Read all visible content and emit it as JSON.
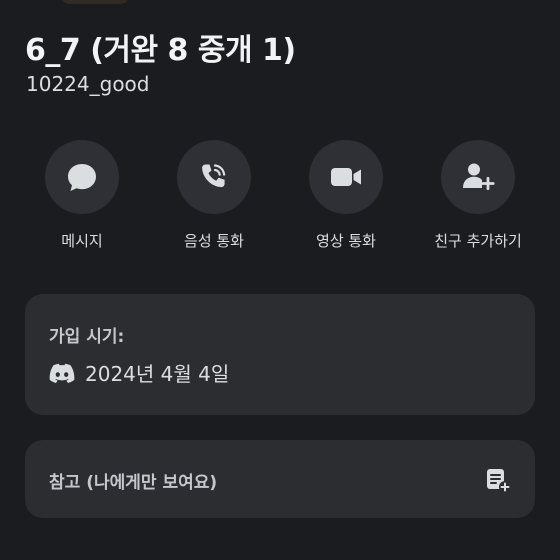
{
  "profile": {
    "display_name": "6_7 (거완 8 중개 1)",
    "username": "10224_good"
  },
  "actions": [
    {
      "label": "메시지",
      "icon": "chat-bubble-icon"
    },
    {
      "label": "음성 통화",
      "icon": "phone-call-icon"
    },
    {
      "label": "영상 통화",
      "icon": "video-camera-icon"
    },
    {
      "label": "친구 추가하기",
      "icon": "add-friend-icon"
    }
  ],
  "joined": {
    "title": "가입 시기:",
    "date": "2024년 4월 4일",
    "icon": "discord-logo-icon"
  },
  "note": {
    "label": "참고 (나에게만 보여요)",
    "icon": "edit-note-icon"
  },
  "colors": {
    "background": "#1b1c20",
    "card": "#2b2d31",
    "action_circle": "#2e3035",
    "text_primary": "#f2f3f5",
    "text_secondary": "#dbdee1"
  }
}
